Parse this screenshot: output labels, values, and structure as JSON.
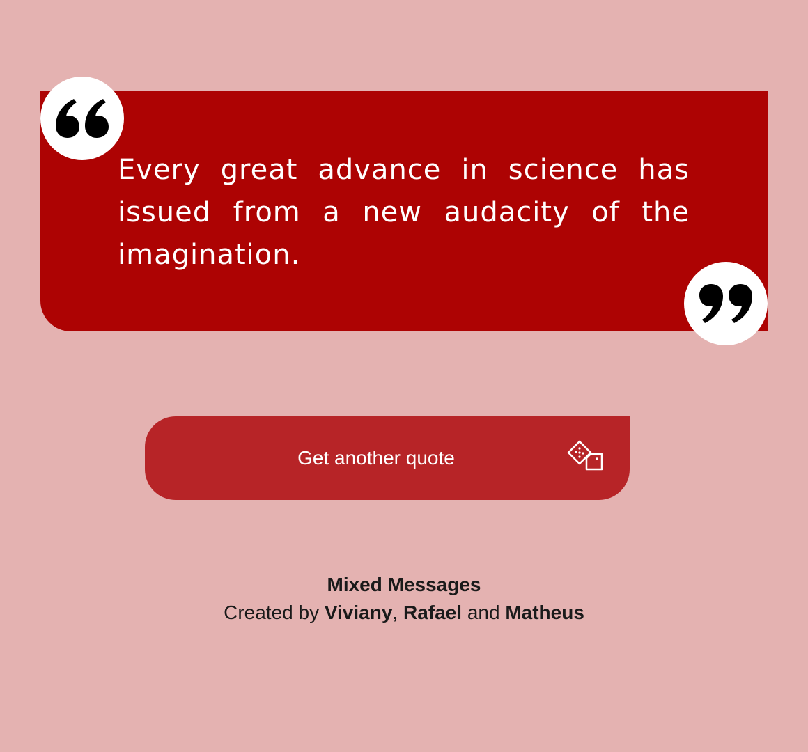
{
  "quote": {
    "text": "Every great advance in science has issued from a new audacity of the imagination.",
    "open_icon": "left-double-quote-icon",
    "close_icon": "right-double-quote-icon"
  },
  "button": {
    "label": "Get another quote",
    "icon": "dice-icon"
  },
  "footer": {
    "title": "Mixed Messages",
    "created_by_prefix": "Created by",
    "author_1": "Viviany",
    "separator_1": ",",
    "author_2": "Rafael",
    "separator_2": "and",
    "author_3": "Matheus"
  },
  "colors": {
    "background": "#e4b2b1",
    "card": "#ad0303",
    "button": "#b72427",
    "text_light": "#ffffff",
    "text_dark": "#1a1a1a"
  }
}
